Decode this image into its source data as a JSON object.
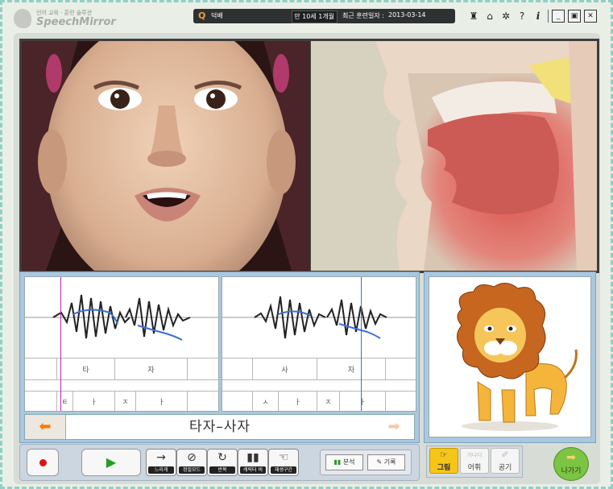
{
  "app": {
    "logo_small": "언어 교육 · 훈련 솔루션",
    "logo_name": "SpeechMirror"
  },
  "header": {
    "user_name": "덕배",
    "user_age": "만 10세 1개월",
    "last_training_label": "최근 훈련일자 :",
    "last_training_date": "2013-03-14",
    "icons": [
      "person-icon",
      "home-icon",
      "gear-icon",
      "help-icon",
      "info-icon",
      "minimize-icon",
      "restore-icon",
      "close-icon"
    ]
  },
  "waveform": {
    "left": {
      "syllables": [
        "타",
        "자"
      ],
      "phonemes": [
        "ㅌ",
        "ㅏ",
        "ㅈ",
        "ㅏ"
      ]
    },
    "right": {
      "syllables": [
        "사",
        "자"
      ],
      "phonemes": [
        "ㅅ",
        "ㅏ",
        "ㅈ",
        "ㅏ"
      ]
    },
    "word": "타자–사자",
    "prev_icon": "left-arrow-icon",
    "next_icon": "right-arrow-icon"
  },
  "controls": {
    "tools": [
      {
        "glyph": "→",
        "label": "느리게"
      },
      {
        "glyph": "⊘",
        "label": "정밀모드"
      },
      {
        "glyph": "↻",
        "label": "반복"
      },
      {
        "glyph": "▮▮",
        "label": "캐릭터 비"
      },
      {
        "glyph": "☜",
        "label": "재생구간"
      }
    ],
    "analysis_label": "분석",
    "record_label": "기록"
  },
  "modes": {
    "picture": "그림",
    "vocab": "어휘",
    "air": "공기",
    "vocab_hint": "가나다"
  },
  "exit_label": "나가기",
  "colors": {
    "accent_orange": "#ff7800",
    "play_green": "#21a020",
    "record_red": "#e01010",
    "pitch_blue": "#3a6fd8",
    "cursor_magenta": "#c020c0"
  }
}
